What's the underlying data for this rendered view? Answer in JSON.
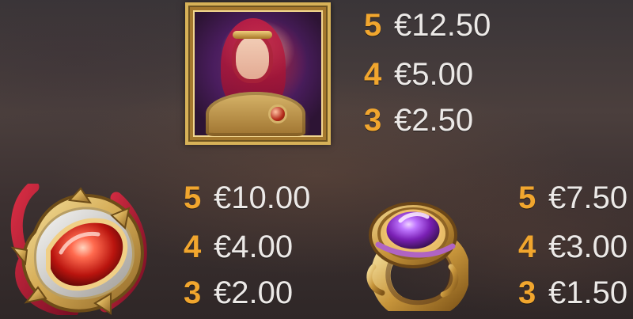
{
  "symbols": [
    {
      "icon": "queen-portrait-icon",
      "payouts": [
        {
          "count": "5",
          "amount": "€12.50"
        },
        {
          "count": "4",
          "amount": "€5.00"
        },
        {
          "count": "3",
          "amount": "€2.50"
        }
      ]
    },
    {
      "icon": "amulet-icon",
      "payouts": [
        {
          "count": "5",
          "amount": "€10.00"
        },
        {
          "count": "4",
          "amount": "€4.00"
        },
        {
          "count": "3",
          "amount": "€2.00"
        }
      ]
    },
    {
      "icon": "ring-icon",
      "payouts": [
        {
          "count": "5",
          "amount": "€7.50"
        },
        {
          "count": "4",
          "amount": "€3.00"
        },
        {
          "count": "3",
          "amount": "€1.50"
        }
      ]
    }
  ],
  "colors": {
    "count": "#f1a62e",
    "amount": "#ece9e7",
    "gold": "#d7b258",
    "background": "#3c3131"
  }
}
